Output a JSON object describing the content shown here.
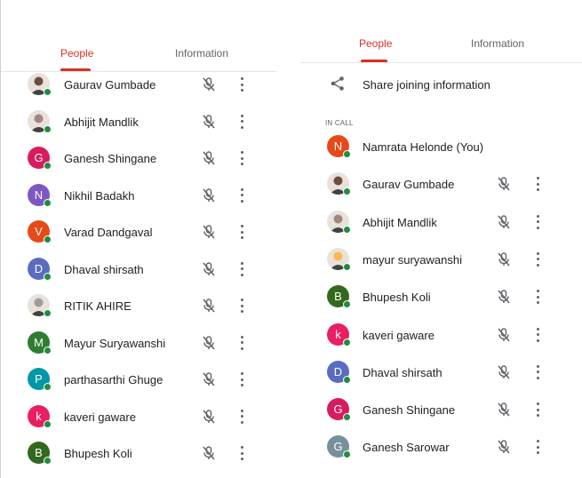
{
  "left": {
    "tabs": [
      {
        "label": "People",
        "active": true
      },
      {
        "label": "Information",
        "active": false
      }
    ],
    "participants": [
      {
        "name": "Gaurav Gumbade",
        "avatar": "photo",
        "color": "#6d4c41"
      },
      {
        "name": "Abhijit Mandlik",
        "avatar": "photo",
        "color": "#a1887f"
      },
      {
        "name": "Ganesh Shingane",
        "avatar": "G",
        "color": "#d81b60"
      },
      {
        "name": "Nikhil Badakh",
        "avatar": "N",
        "color": "#7e57c2"
      },
      {
        "name": "Varad Dandgaval",
        "avatar": "V",
        "color": "#e64a19"
      },
      {
        "name": "Dhaval shirsath",
        "avatar": "D",
        "color": "#5c6bc0"
      },
      {
        "name": "RITIK AHIRE",
        "avatar": "photo",
        "color": "#9e9e9e"
      },
      {
        "name": "Mayur Suryawanshi",
        "avatar": "M",
        "color": "#2e7d32"
      },
      {
        "name": "parthasarthi Ghuge",
        "avatar": "P",
        "color": "#0097a7"
      },
      {
        "name": "kaveri gaware",
        "avatar": "k",
        "color": "#e91e63"
      },
      {
        "name": "Bhupesh Koli",
        "avatar": "B",
        "color": "#33691e"
      }
    ]
  },
  "right": {
    "tabs": [
      {
        "label": "People",
        "active": true
      },
      {
        "label": "Information",
        "active": false
      }
    ],
    "share_label": "Share joining information",
    "section_label": "IN CALL",
    "participants": [
      {
        "name": "Namrata Helonde (You)",
        "avatar": "N",
        "color": "#e64a19",
        "self": true
      },
      {
        "name": "Gaurav Gumbade",
        "avatar": "photo",
        "color": "#6d4c41"
      },
      {
        "name": "Abhijit Mandlik",
        "avatar": "photo",
        "color": "#a1887f"
      },
      {
        "name": "mayur suryawanshi",
        "avatar": "photo",
        "color": "#ffb74d"
      },
      {
        "name": "Bhupesh Koli",
        "avatar": "B",
        "color": "#33691e"
      },
      {
        "name": "kaveri gaware",
        "avatar": "k",
        "color": "#e91e63"
      },
      {
        "name": "Dhaval shirsath",
        "avatar": "D",
        "color": "#5c6bc0"
      },
      {
        "name": "Ganesh Shingane",
        "avatar": "G",
        "color": "#d81b60"
      },
      {
        "name": "Ganesh Sarowar",
        "avatar": "G",
        "color": "#78909c"
      }
    ]
  },
  "icons": {
    "mic": "mic-off-icon",
    "more": "more-vert-icon",
    "share": "share-icon"
  },
  "colors": {
    "accent": "#d93025",
    "online": "#1e8e3e"
  }
}
